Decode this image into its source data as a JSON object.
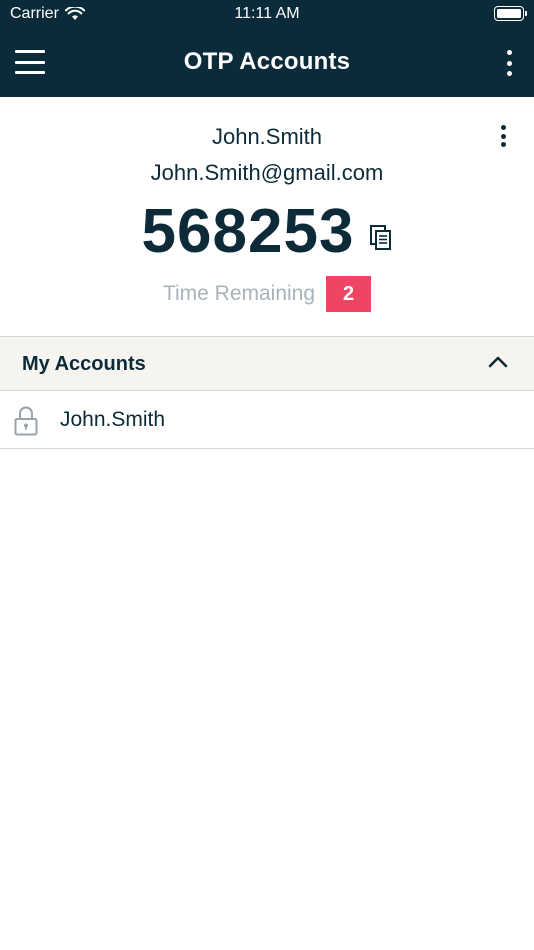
{
  "status_bar": {
    "carrier": "Carrier",
    "time": "11:11 AM"
  },
  "nav": {
    "title": "OTP Accounts",
    "icons": [
      "hamburger-menu-icon",
      "more-vertical-icon"
    ]
  },
  "otp_card": {
    "account_name": "John.Smith",
    "account_email": "John.Smith@gmail.com",
    "code": "568253",
    "time_remaining_label": "Time Remaining",
    "time_remaining_value": "2"
  },
  "accounts_section": {
    "title": "My Accounts",
    "items": [
      {
        "label": "John.Smith",
        "icon": "lock-icon"
      }
    ]
  },
  "colors": {
    "header_background": "#0b2a3a",
    "text_primary": "#0d2a38",
    "badge_background": "#ef4564",
    "muted_text": "#a9b3bb",
    "section_background": "#f6f4ef",
    "divider": "#d6d6d6"
  }
}
